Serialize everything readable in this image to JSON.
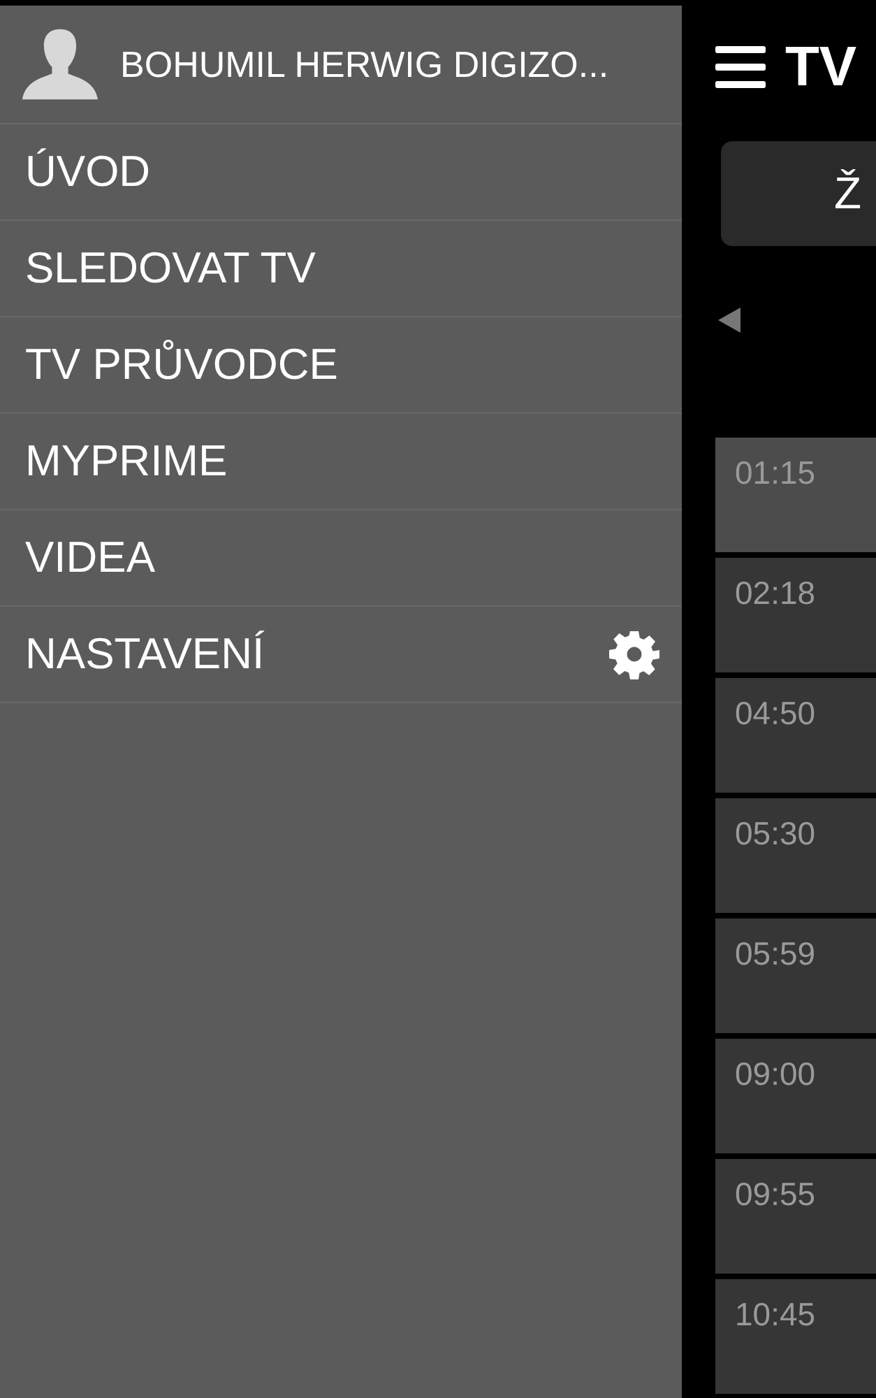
{
  "drawer": {
    "user_name": "BOHUMIL HERWIG DIGIZO...",
    "items": [
      {
        "label": "ÚVOD",
        "kind": "link"
      },
      {
        "label": "SLEDOVAT TV",
        "kind": "link"
      },
      {
        "label": "TV PRŮVODCE",
        "kind": "link"
      },
      {
        "label": "MYPRIME",
        "kind": "link"
      },
      {
        "label": "VIDEA",
        "kind": "link"
      },
      {
        "label": "NASTAVENÍ",
        "kind": "settings"
      }
    ]
  },
  "header": {
    "title": "TV"
  },
  "day_button": {
    "label": "Ž"
  },
  "programmes": [
    {
      "time": "01:15",
      "selected": true
    },
    {
      "time": "02:18",
      "selected": false
    },
    {
      "time": "04:50",
      "selected": false
    },
    {
      "time": "05:30",
      "selected": false
    },
    {
      "time": "05:59",
      "selected": false
    },
    {
      "time": "09:00",
      "selected": false
    },
    {
      "time": "09:55",
      "selected": false
    },
    {
      "time": "10:45",
      "selected": false
    }
  ]
}
